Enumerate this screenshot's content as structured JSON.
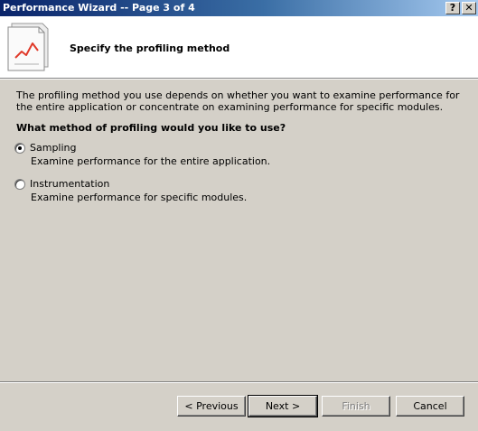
{
  "window": {
    "title": "Performance Wizard -- Page 3 of 4",
    "help_label": "?",
    "close_label": "✕"
  },
  "header": {
    "title": "Specify the profiling method",
    "icon": "chart-document-icon"
  },
  "body": {
    "description": "The profiling method you use depends on whether you want to examine performance for the entire application or concentrate on examining performance for specific modules.",
    "question": "What method of profiling would you like to use?"
  },
  "options": [
    {
      "label": "Sampling",
      "description": "Examine performance for the entire application.",
      "selected": true
    },
    {
      "label": "Instrumentation",
      "description": "Examine performance for specific modules.",
      "selected": false
    }
  ],
  "buttons": {
    "previous": "< Previous",
    "next": "Next >",
    "finish": "Finish",
    "cancel": "Cancel"
  },
  "colors": {
    "titlebar_start": "#0a246a",
    "titlebar_end": "#a6caf0",
    "dialog_bg": "#d4d0c8",
    "chart_line": "#e03a2a"
  }
}
